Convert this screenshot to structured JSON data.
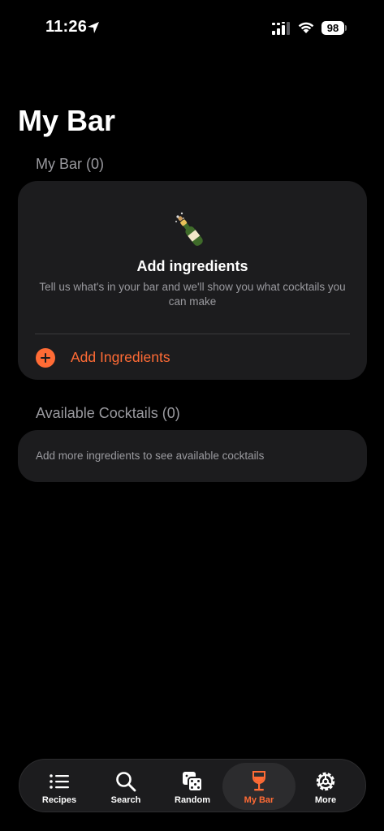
{
  "status_bar": {
    "time": "11:26",
    "battery": "98"
  },
  "page": {
    "title": "My Bar"
  },
  "my_bar_section": {
    "header": "My Bar (0)",
    "empty_title": "Add ingredients",
    "empty_description": "Tell us what's in your bar and we'll show you what cocktails you can make",
    "add_button_label": "Add Ingredients",
    "icon": "champagne-bottle-icon"
  },
  "cocktails_section": {
    "header": "Available Cocktails (0)",
    "empty_message": "Add more ingredients to see available cocktails"
  },
  "tab_bar": {
    "tabs": [
      {
        "label": "Recipes",
        "icon": "list-icon"
      },
      {
        "label": "Search",
        "icon": "search-icon"
      },
      {
        "label": "Random",
        "icon": "dice-icon"
      },
      {
        "label": "My Bar",
        "icon": "wine-glass-icon",
        "active": true
      },
      {
        "label": "More",
        "icon": "gear-icon"
      }
    ]
  },
  "colors": {
    "accent": "#ff6b35",
    "card": "#1c1c1e",
    "background": "#000000",
    "secondary_text": "#9a9a9f"
  }
}
